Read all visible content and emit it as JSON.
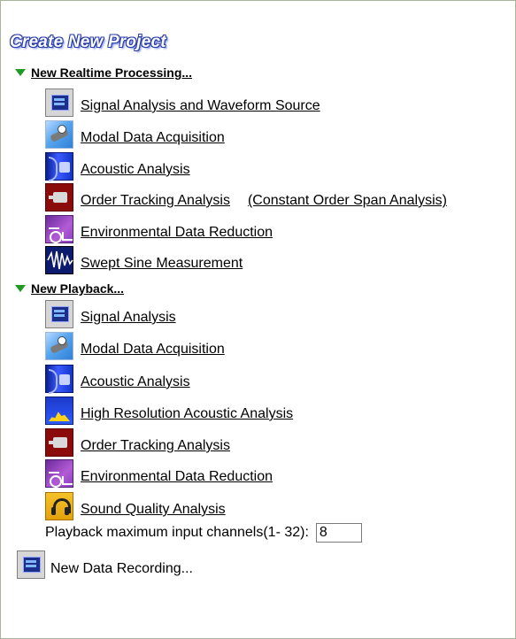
{
  "title": "Create New Project",
  "realtime": {
    "header": "New Realtime Processing...",
    "items": [
      {
        "label": "Signal Analysis and Waveform Source",
        "icon": "signal-analysis-icon"
      },
      {
        "label": "Modal Data Acquisition",
        "icon": "modal-data-icon"
      },
      {
        "label": "Acoustic Analysis",
        "icon": "acoustic-analysis-icon"
      },
      {
        "label": "Order Tracking Analysis",
        "icon": "order-tracking-icon",
        "extra": "(Constant Order Span Analysis)"
      },
      {
        "label": "Environmental Data Reduction",
        "icon": "environmental-data-icon"
      },
      {
        "label": "Swept Sine Measurement",
        "icon": "swept-sine-icon"
      }
    ]
  },
  "playback": {
    "header": "New Playback...",
    "items": [
      {
        "label": "Signal Analysis",
        "icon": "signal-analysis-icon"
      },
      {
        "label": "Modal Data Acquisition",
        "icon": "modal-data-icon"
      },
      {
        "label": "Acoustic Analysis",
        "icon": "acoustic-analysis-icon"
      },
      {
        "label": "High Resolution Acoustic Analysis",
        "icon": "high-resolution-icon"
      },
      {
        "label": "Order Tracking Analysis",
        "icon": "order-tracking-icon"
      },
      {
        "label": "Environmental Data Reduction",
        "icon": "environmental-data-icon"
      },
      {
        "label": "Sound Quality Analysis",
        "icon": "sound-quality-icon"
      }
    ],
    "max_channels_label": "Playback maximum input channels(1- 32):",
    "max_channels_value": "8"
  },
  "recording": {
    "label": "New Data Recording...",
    "icon": "data-recording-icon"
  },
  "colors": {
    "triangle": "#1f9a23",
    "title_outline": "#2a3ea8"
  }
}
